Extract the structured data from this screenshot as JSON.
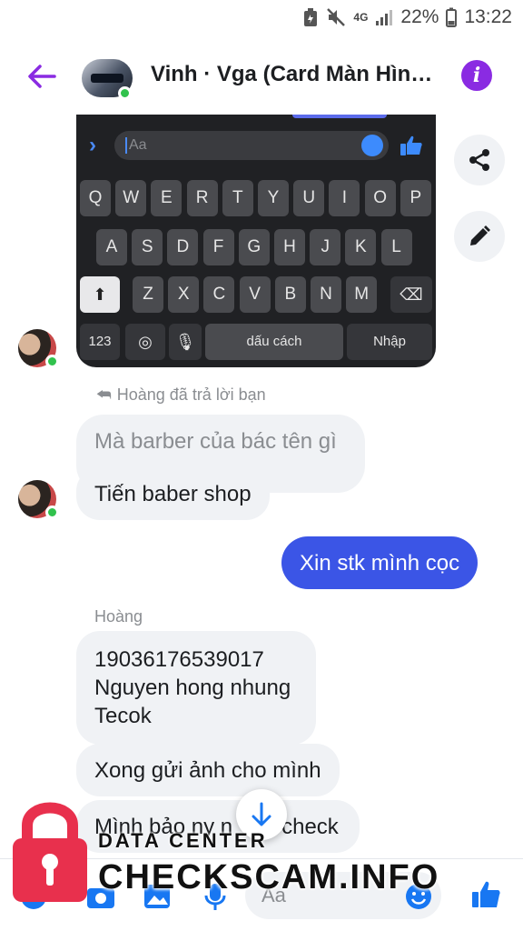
{
  "status_bar": {
    "battery_percent": "22%",
    "time": "13:22",
    "network": "4G"
  },
  "header": {
    "title": "Vinh · Vga (Card Màn Hìn…"
  },
  "shared_image": {
    "input_placeholder": "Aa",
    "rows": [
      [
        "Q",
        "W",
        "E",
        "R",
        "T",
        "Y",
        "U",
        "I",
        "O",
        "P"
      ],
      [
        "A",
        "S",
        "D",
        "F",
        "G",
        "H",
        "J",
        "K",
        "L"
      ],
      [
        "Z",
        "X",
        "C",
        "V",
        "B",
        "N",
        "M"
      ]
    ],
    "key_123": "123",
    "space_label": "dấu cách",
    "enter_label": "Nhập"
  },
  "messages": {
    "reply_note": "Hoàng đã trả lời bạn",
    "quoted": "Mà barber của bác tên gì",
    "reply": "Tiến baber shop",
    "outgoing": "Xin stk mình cọc",
    "sender": "Hoàng",
    "account_lines": [
      "19036176539017",
      "Nguyen hong nhung",
      "Tecok"
    ],
    "msg2": "Xong gửi ảnh cho mình",
    "msg3": "Mình bảo ny n",
    "msg3_tail": "check"
  },
  "composer": {
    "placeholder": "Aa"
  },
  "watermark": {
    "top": "DATA CENTER",
    "main": "CHECKSCAM.INFO"
  },
  "colors": {
    "accent": "#8a2be2",
    "outgoing_bubble": "#3b55e6",
    "composer_icon": "#1877f2",
    "online": "#31c24d"
  }
}
